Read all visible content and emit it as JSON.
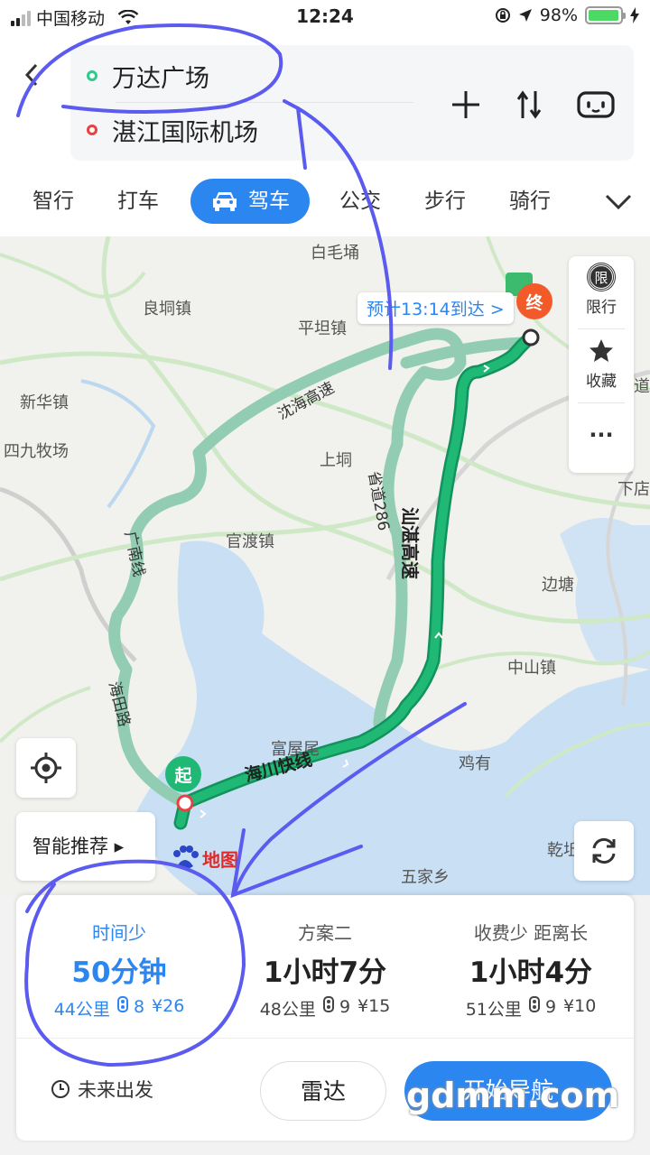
{
  "status_bar": {
    "carrier": "中国移动",
    "time": "12:24",
    "battery": "98%",
    "battery_level": 0.98
  },
  "route": {
    "start": "万达广场",
    "end": "湛江国际机场"
  },
  "icons": {
    "back": "chevron-left-icon",
    "add_waypoint": "plus-icon",
    "swap": "swap-icon",
    "voice": "voice-icon",
    "car": "car-icon",
    "expand": "chevron-down-icon",
    "restriction": "restriction-icon",
    "favorite": "star-icon",
    "more": "more-icon",
    "locate": "locate-icon",
    "refresh": "refresh-icon",
    "clock": "clock-icon",
    "traffic_light": "traffic-light-icon"
  },
  "tabs": [
    {
      "label": "智行"
    },
    {
      "label": "打车"
    },
    {
      "label": "驾车",
      "active": true
    },
    {
      "label": "公交"
    },
    {
      "label": "步行"
    },
    {
      "label": "骑行"
    }
  ],
  "map": {
    "eta": "预计13:14到达 >",
    "start_marker": "起",
    "end_marker": "终",
    "places": [
      "白毛埇",
      "良垌镇",
      "平坦镇",
      "新华镇",
      "四九牧场",
      "上垌",
      "官渡镇",
      "边塘",
      "中山镇",
      "富屋尾",
      "鸡有",
      "五家乡",
      "下店",
      "乾坵",
      "道"
    ],
    "roads": [
      "沈海高速",
      "汕湛高速",
      "省道286",
      "广南线",
      "海田路",
      "海川快线"
    ],
    "side_panel": {
      "restriction_badge": "限",
      "restriction": "限行",
      "favorite": "收藏",
      "more": "···"
    },
    "smart_recommend": "智能推荐 ▸",
    "logo": "地图"
  },
  "colors": {
    "accent": "#2c86f0",
    "route_primary": "#1fb874",
    "route_alt": "#8fcbb0",
    "annotation": "#5b5bf0"
  },
  "route_options": [
    {
      "tag": "时间少",
      "duration": "50分钟",
      "distance": "44公里",
      "lights": "8",
      "toll": "¥26",
      "selected": true
    },
    {
      "tag": "方案二",
      "duration": "1小时7分",
      "distance": "48公里",
      "lights": "9",
      "toll": "¥15"
    },
    {
      "tag": "收费少 距离长",
      "duration": "1小时4分",
      "distance": "51公里",
      "lights": "9",
      "toll": "¥10"
    }
  ],
  "bottom": {
    "future_departure": "未来出发",
    "radar": "雷达",
    "start_navigation": "开始导航"
  },
  "watermark": "gdmm.com"
}
